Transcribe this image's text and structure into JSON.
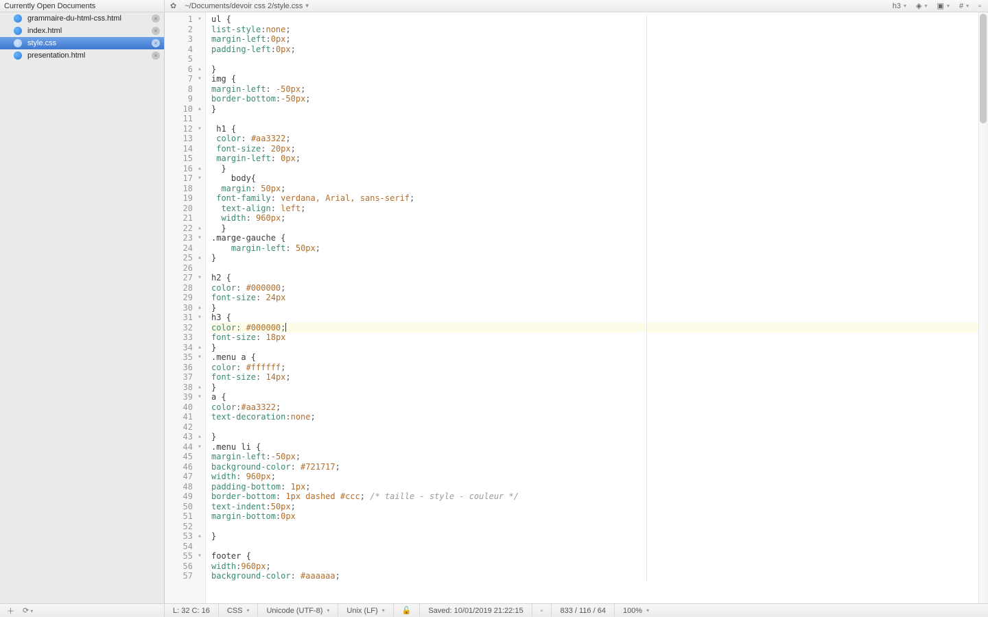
{
  "topbar": {
    "sidebar_title": "Currently Open Documents",
    "file_path": "~/Documents/devoir css 2/style.css",
    "right_label_h3": "h3",
    "right_hash": "#"
  },
  "sidebar": {
    "items": [
      {
        "name": "grammaire-du-html-css.html",
        "active": false
      },
      {
        "name": "index.html",
        "active": false
      },
      {
        "name": "style.css",
        "active": true
      },
      {
        "name": "presentation.html",
        "active": false
      }
    ]
  },
  "editor": {
    "lines": [
      {
        "n": 1,
        "fold": "open",
        "segs": [
          [
            "ul {",
            "sel"
          ]
        ]
      },
      {
        "n": 2,
        "segs": [
          [
            "list-style",
            "prop"
          ],
          [
            ":",
            "punc"
          ],
          [
            "none",
            "val"
          ],
          [
            ";",
            "punc"
          ]
        ]
      },
      {
        "n": 3,
        "segs": [
          [
            "margin-left",
            "prop"
          ],
          [
            ":",
            "punc"
          ],
          [
            "0",
            "num"
          ],
          [
            "px",
            "val"
          ],
          [
            ";",
            "punc"
          ]
        ]
      },
      {
        "n": 4,
        "segs": [
          [
            "padding-left",
            "prop"
          ],
          [
            ":",
            "punc"
          ],
          [
            "0",
            "num"
          ],
          [
            "px",
            "val"
          ],
          [
            ";",
            "punc"
          ]
        ]
      },
      {
        "n": 5,
        "segs": []
      },
      {
        "n": 6,
        "fold": "close",
        "segs": [
          [
            "}",
            "sel"
          ]
        ]
      },
      {
        "n": 7,
        "fold": "open",
        "segs": [
          [
            "img {",
            "sel"
          ]
        ]
      },
      {
        "n": 8,
        "segs": [
          [
            "margin-left",
            "prop"
          ],
          [
            ": ",
            "punc"
          ],
          [
            "-50",
            "num"
          ],
          [
            "px",
            "val"
          ],
          [
            ";",
            "punc"
          ]
        ]
      },
      {
        "n": 9,
        "segs": [
          [
            "border-bottom",
            "prop"
          ],
          [
            ":",
            "punc"
          ],
          [
            "-50",
            "num"
          ],
          [
            "px",
            "val"
          ],
          [
            ";",
            "punc"
          ]
        ]
      },
      {
        "n": 10,
        "fold": "close",
        "segs": [
          [
            "}",
            "sel"
          ]
        ]
      },
      {
        "n": 11,
        "segs": []
      },
      {
        "n": 12,
        "fold": "open",
        "indent": 1,
        "segs": [
          [
            "h1 {",
            "sel"
          ]
        ]
      },
      {
        "n": 13,
        "indent": 1,
        "segs": [
          [
            "color",
            "prop"
          ],
          [
            ": ",
            "punc"
          ],
          [
            "#aa3322",
            "hex"
          ],
          [
            ";",
            "punc"
          ]
        ]
      },
      {
        "n": 14,
        "indent": 1,
        "segs": [
          [
            "font-size",
            "prop"
          ],
          [
            ": ",
            "punc"
          ],
          [
            "20",
            "num"
          ],
          [
            "px",
            "val"
          ],
          [
            ";",
            "punc"
          ]
        ]
      },
      {
        "n": 15,
        "indent": 1,
        "segs": [
          [
            "margin-left",
            "prop"
          ],
          [
            ": ",
            "punc"
          ],
          [
            "0",
            "num"
          ],
          [
            "px",
            "val"
          ],
          [
            ";",
            "punc"
          ]
        ]
      },
      {
        "n": 16,
        "fold": "close",
        "indent": 2,
        "segs": [
          [
            "}",
            "sel"
          ]
        ]
      },
      {
        "n": 17,
        "fold": "open",
        "indent": 4,
        "segs": [
          [
            "body{",
            "sel"
          ]
        ]
      },
      {
        "n": 18,
        "indent": 2,
        "segs": [
          [
            "margin",
            "prop"
          ],
          [
            ": ",
            "punc"
          ],
          [
            "50",
            "num"
          ],
          [
            "px",
            "val"
          ],
          [
            ";",
            "punc"
          ]
        ]
      },
      {
        "n": 19,
        "indent": 1,
        "segs": [
          [
            "font-family",
            "prop"
          ],
          [
            ": ",
            "punc"
          ],
          [
            "verdana, Arial, sans-serif",
            "val"
          ],
          [
            ";",
            "punc"
          ]
        ]
      },
      {
        "n": 20,
        "indent": 2,
        "segs": [
          [
            "text-align",
            "prop"
          ],
          [
            ": ",
            "punc"
          ],
          [
            "left",
            "val"
          ],
          [
            ";",
            "punc"
          ]
        ]
      },
      {
        "n": 21,
        "indent": 2,
        "segs": [
          [
            "width",
            "prop"
          ],
          [
            ": ",
            "punc"
          ],
          [
            "960",
            "num"
          ],
          [
            "px",
            "val"
          ],
          [
            ";",
            "punc"
          ]
        ]
      },
      {
        "n": 22,
        "fold": "close",
        "indent": 2,
        "segs": [
          [
            "}",
            "sel"
          ]
        ]
      },
      {
        "n": 23,
        "fold": "open",
        "segs": [
          [
            ".marge-gauche {",
            "sel"
          ]
        ]
      },
      {
        "n": 24,
        "indent": 4,
        "segs": [
          [
            "margin-left",
            "prop"
          ],
          [
            ": ",
            "punc"
          ],
          [
            "50",
            "num"
          ],
          [
            "px",
            "val"
          ],
          [
            ";",
            "punc"
          ]
        ]
      },
      {
        "n": 25,
        "fold": "close",
        "segs": [
          [
            "}",
            "sel"
          ]
        ]
      },
      {
        "n": 26,
        "segs": []
      },
      {
        "n": 27,
        "fold": "open",
        "segs": [
          [
            "h2 {",
            "sel"
          ]
        ]
      },
      {
        "n": 28,
        "segs": [
          [
            "color",
            "prop"
          ],
          [
            ": ",
            "punc"
          ],
          [
            "#000000",
            "hex"
          ],
          [
            ";",
            "punc"
          ]
        ]
      },
      {
        "n": 29,
        "segs": [
          [
            "font-size",
            "prop"
          ],
          [
            ": ",
            "punc"
          ],
          [
            "24",
            "num"
          ],
          [
            "px",
            "val"
          ]
        ]
      },
      {
        "n": 30,
        "fold": "close",
        "segs": [
          [
            "}",
            "sel"
          ]
        ]
      },
      {
        "n": 31,
        "fold": "open",
        "segs": [
          [
            "h3 {",
            "sel"
          ]
        ]
      },
      {
        "n": 32,
        "hl": true,
        "cursor": true,
        "segs": [
          [
            "color",
            "prop"
          ],
          [
            ": ",
            "punc"
          ],
          [
            "#000000",
            "hex"
          ],
          [
            ";",
            "punc"
          ]
        ]
      },
      {
        "n": 33,
        "segs": [
          [
            "font-size",
            "prop"
          ],
          [
            ": ",
            "punc"
          ],
          [
            "18",
            "num"
          ],
          [
            "px",
            "val"
          ]
        ]
      },
      {
        "n": 34,
        "fold": "close",
        "segs": [
          [
            "}",
            "sel"
          ]
        ]
      },
      {
        "n": 35,
        "fold": "open",
        "segs": [
          [
            ".menu a {",
            "sel"
          ]
        ]
      },
      {
        "n": 36,
        "segs": [
          [
            "color",
            "prop"
          ],
          [
            ": ",
            "punc"
          ],
          [
            "#ffffff",
            "hex"
          ],
          [
            ";",
            "punc"
          ]
        ]
      },
      {
        "n": 37,
        "segs": [
          [
            "font-size",
            "prop"
          ],
          [
            ": ",
            "punc"
          ],
          [
            "14",
            "num"
          ],
          [
            "px",
            "val"
          ],
          [
            ";",
            "punc"
          ]
        ]
      },
      {
        "n": 38,
        "fold": "close",
        "segs": [
          [
            "}",
            "sel"
          ]
        ]
      },
      {
        "n": 39,
        "fold": "open",
        "segs": [
          [
            "a {",
            "sel"
          ]
        ]
      },
      {
        "n": 40,
        "segs": [
          [
            "color",
            "prop"
          ],
          [
            ":",
            "punc"
          ],
          [
            "#aa3322",
            "hex"
          ],
          [
            ";",
            "punc"
          ]
        ]
      },
      {
        "n": 41,
        "segs": [
          [
            "text-decoration",
            "prop"
          ],
          [
            ":",
            "punc"
          ],
          [
            "none",
            "val"
          ],
          [
            ";",
            "punc"
          ]
        ]
      },
      {
        "n": 42,
        "segs": []
      },
      {
        "n": 43,
        "fold": "close",
        "segs": [
          [
            "}",
            "sel"
          ]
        ]
      },
      {
        "n": 44,
        "fold": "open",
        "segs": [
          [
            ".menu li {",
            "sel"
          ]
        ]
      },
      {
        "n": 45,
        "segs": [
          [
            "margin-left",
            "prop"
          ],
          [
            ":",
            "punc"
          ],
          [
            "-50",
            "num"
          ],
          [
            "px",
            "val"
          ],
          [
            ";",
            "punc"
          ]
        ]
      },
      {
        "n": 46,
        "segs": [
          [
            "background-color",
            "prop"
          ],
          [
            ": ",
            "punc"
          ],
          [
            "#721717",
            "hex"
          ],
          [
            ";",
            "punc"
          ]
        ]
      },
      {
        "n": 47,
        "segs": [
          [
            "width",
            "prop"
          ],
          [
            ": ",
            "punc"
          ],
          [
            "960",
            "num"
          ],
          [
            "px",
            "val"
          ],
          [
            ";",
            "punc"
          ]
        ]
      },
      {
        "n": 48,
        "segs": [
          [
            "padding-bottom",
            "prop"
          ],
          [
            ": ",
            "punc"
          ],
          [
            "1",
            "num"
          ],
          [
            "px",
            "val"
          ],
          [
            ";",
            "punc"
          ]
        ]
      },
      {
        "n": 49,
        "segs": [
          [
            "border-bottom",
            "prop"
          ],
          [
            ": ",
            "punc"
          ],
          [
            "1",
            "num"
          ],
          [
            "px",
            "val"
          ],
          [
            " dashed ",
            "val"
          ],
          [
            "#ccc",
            "hex"
          ],
          [
            "; ",
            "punc"
          ],
          [
            "/* taille - style - couleur */",
            "comm"
          ]
        ]
      },
      {
        "n": 50,
        "segs": [
          [
            "text-indent",
            "prop"
          ],
          [
            ":",
            "punc"
          ],
          [
            "50",
            "num"
          ],
          [
            "px",
            "val"
          ],
          [
            ";",
            "punc"
          ]
        ]
      },
      {
        "n": 51,
        "segs": [
          [
            "margin-bottom",
            "prop"
          ],
          [
            ":",
            "punc"
          ],
          [
            "0",
            "num"
          ],
          [
            "px",
            "val"
          ]
        ]
      },
      {
        "n": 52,
        "segs": []
      },
      {
        "n": 53,
        "fold": "close",
        "segs": [
          [
            "}",
            "sel"
          ]
        ]
      },
      {
        "n": 54,
        "segs": []
      },
      {
        "n": 55,
        "fold": "open",
        "segs": [
          [
            "footer {",
            "sel"
          ]
        ]
      },
      {
        "n": 56,
        "segs": [
          [
            "width",
            "prop"
          ],
          [
            ":",
            "punc"
          ],
          [
            "960",
            "num"
          ],
          [
            "px",
            "val"
          ],
          [
            ";",
            "punc"
          ]
        ]
      },
      {
        "n": 57,
        "segs": [
          [
            "background-color",
            "prop"
          ],
          [
            ": ",
            "punc"
          ],
          [
            "#aaaaaa",
            "hex"
          ],
          [
            ";",
            "punc"
          ]
        ]
      }
    ]
  },
  "status": {
    "cursor": "L: 32 C: 16",
    "lang": "CSS",
    "encoding": "Unicode (UTF-8)",
    "line_ending": "Unix (LF)",
    "saved": "Saved: 10/01/2019 21:22:15",
    "counts": "833 / 116 / 64",
    "zoom": "100%"
  }
}
